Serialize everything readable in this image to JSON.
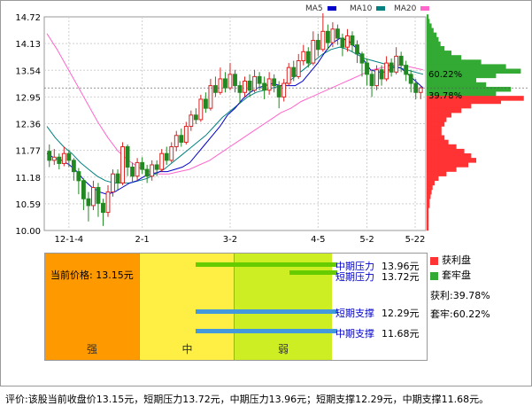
{
  "legend": [
    {
      "label": "MA5",
      "color": "#0000cc"
    },
    {
      "label": "MA10",
      "color": "#008080"
    },
    {
      "label": "MA20",
      "color": "#ff66cc"
    }
  ],
  "chart_data": {
    "type": "candlestick",
    "y_ticks": [
      "14.72",
      "14.13",
      "13.54",
      "12.95",
      "12.36",
      "11.77",
      "11.18",
      "10.59",
      "10.00"
    ],
    "ylim": [
      10.0,
      14.72
    ],
    "x_ticks": [
      "12-1-4",
      "2-1",
      "3-2",
      "4-5",
      "5-2",
      "5-22"
    ],
    "candles": [
      [
        11.75,
        11.55,
        11.9,
        11.4
      ],
      [
        11.55,
        11.62,
        11.8,
        11.45
      ],
      [
        11.62,
        11.48,
        11.7,
        11.35
      ],
      [
        11.48,
        11.7,
        11.85,
        11.42
      ],
      [
        11.7,
        11.55,
        11.78,
        11.4
      ],
      [
        11.55,
        11.3,
        11.6,
        11.1
      ],
      [
        11.3,
        11.1,
        11.38,
        10.8
      ],
      [
        11.1,
        10.7,
        11.15,
        10.45
      ],
      [
        10.7,
        10.55,
        10.85,
        10.2
      ],
      [
        10.55,
        10.95,
        11.1,
        10.45
      ],
      [
        10.95,
        10.6,
        11.05,
        10.3
      ],
      [
        10.6,
        10.4,
        10.7,
        10.1
      ],
      [
        10.4,
        10.85,
        11.0,
        10.3
      ],
      [
        10.85,
        11.25,
        11.35,
        10.75
      ],
      [
        11.25,
        11.05,
        11.35,
        10.9
      ],
      [
        11.05,
        11.85,
        11.95,
        11.0
      ],
      [
        11.85,
        11.4,
        11.9,
        11.2
      ],
      [
        11.4,
        11.2,
        11.5,
        11.05
      ],
      [
        11.2,
        11.5,
        11.6,
        11.1
      ],
      [
        11.5,
        11.35,
        11.62,
        11.25
      ],
      [
        11.35,
        11.2,
        11.45,
        11.05
      ],
      [
        11.2,
        11.45,
        11.55,
        11.1
      ],
      [
        11.45,
        11.35,
        11.55,
        11.2
      ],
      [
        11.35,
        11.7,
        11.8,
        11.3
      ],
      [
        11.7,
        11.55,
        11.85,
        11.45
      ],
      [
        11.55,
        11.85,
        11.95,
        11.5
      ],
      [
        11.85,
        12.1,
        12.2,
        11.75
      ],
      [
        12.1,
        11.95,
        12.25,
        11.85
      ],
      [
        11.95,
        12.3,
        12.4,
        11.9
      ],
      [
        12.3,
        12.55,
        12.65,
        12.2
      ],
      [
        12.55,
        12.45,
        12.7,
        12.35
      ],
      [
        12.45,
        12.9,
        13.0,
        12.4
      ],
      [
        12.9,
        12.7,
        13.05,
        12.6
      ],
      [
        12.7,
        13.2,
        13.35,
        12.65
      ],
      [
        13.2,
        13.05,
        13.4,
        12.95
      ],
      [
        13.05,
        13.35,
        13.6,
        13.0
      ],
      [
        13.35,
        13.15,
        13.5,
        13.05
      ],
      [
        13.15,
        13.45,
        13.7,
        13.1
      ],
      [
        13.45,
        13.2,
        13.55,
        13.05
      ],
      [
        13.2,
        13.05,
        13.3,
        12.8
      ],
      [
        13.05,
        13.3,
        13.4,
        12.95
      ],
      [
        13.3,
        13.1,
        13.45,
        12.95
      ],
      [
        13.1,
        13.4,
        13.55,
        13.05
      ],
      [
        13.4,
        13.25,
        13.5,
        13.1
      ],
      [
        13.25,
        13.1,
        13.4,
        12.9
      ],
      [
        13.1,
        13.35,
        13.5,
        13.0
      ],
      [
        13.35,
        13.2,
        13.45,
        13.05
      ],
      [
        13.2,
        12.95,
        13.3,
        12.7
      ],
      [
        12.95,
        13.25,
        13.35,
        12.85
      ],
      [
        13.25,
        13.6,
        13.7,
        13.2
      ],
      [
        13.6,
        13.4,
        13.75,
        13.3
      ],
      [
        13.4,
        13.75,
        13.9,
        13.35
      ],
      [
        13.75,
        13.95,
        14.1,
        13.65
      ],
      [
        13.95,
        13.7,
        14.05,
        13.6
      ],
      [
        13.7,
        14.2,
        14.4,
        13.65
      ],
      [
        14.2,
        14.0,
        14.35,
        13.85
      ],
      [
        14.0,
        14.4,
        14.8,
        13.95
      ],
      [
        14.4,
        14.15,
        14.55,
        14.0
      ],
      [
        14.15,
        14.45,
        14.6,
        14.05
      ],
      [
        14.45,
        14.25,
        14.55,
        14.1
      ],
      [
        14.25,
        14.05,
        14.35,
        13.85
      ],
      [
        14.05,
        14.3,
        14.45,
        13.95
      ],
      [
        14.3,
        14.1,
        14.4,
        13.95
      ],
      [
        14.1,
        13.9,
        14.2,
        13.7
      ],
      [
        13.9,
        13.7,
        13.95,
        13.4
      ],
      [
        13.7,
        13.45,
        13.8,
        13.2
      ],
      [
        13.45,
        13.2,
        13.55,
        12.95
      ],
      [
        13.2,
        13.55,
        13.65,
        13.1
      ],
      [
        13.55,
        13.35,
        13.65,
        13.2
      ],
      [
        13.35,
        13.7,
        13.85,
        13.3
      ],
      [
        13.7,
        13.5,
        13.8,
        13.4
      ],
      [
        13.5,
        13.85,
        14.05,
        13.45
      ],
      [
        13.85,
        13.65,
        13.95,
        13.5
      ],
      [
        13.65,
        13.45,
        13.75,
        13.3
      ],
      [
        13.45,
        13.25,
        13.55,
        13.05
      ],
      [
        13.25,
        13.05,
        13.35,
        12.9
      ],
      [
        13.05,
        13.15,
        13.2,
        12.9
      ]
    ],
    "ma5": [
      11.7,
      11.6,
      11.55,
      11.45,
      11.3,
      11.1,
      10.95,
      10.85,
      10.8,
      10.85,
      10.95,
      11.05,
      11.1,
      11.2,
      11.25,
      11.3,
      11.3,
      11.35,
      11.4,
      11.5,
      11.7,
      11.9,
      12.1,
      12.3,
      12.55,
      12.7,
      12.9,
      13.05,
      13.15,
      13.2,
      13.25,
      13.2,
      13.2,
      13.2,
      13.3,
      13.5,
      13.7,
      13.95,
      14.15,
      14.25,
      14.2,
      14.05,
      13.8,
      13.55,
      13.5,
      13.5,
      13.6,
      13.6,
      13.45,
      13.3,
      13.15
    ],
    "ma10": [
      12.3,
      12.05,
      11.85,
      11.7,
      11.5,
      11.35,
      11.2,
      11.1,
      11.05,
      11.05,
      11.05,
      11.1,
      11.15,
      11.25,
      11.35,
      11.5,
      11.65,
      11.8,
      11.95,
      12.1,
      12.3,
      12.5,
      12.65,
      12.8,
      12.95,
      13.05,
      13.1,
      13.15,
      13.2,
      13.3,
      13.45,
      13.6,
      13.75,
      13.9,
      14.0,
      14.05,
      14.0,
      13.9,
      13.8,
      13.75,
      13.7,
      13.65,
      13.6,
      13.55,
      13.5,
      13.45
    ],
    "ma20": [
      14.35,
      14.0,
      13.6,
      13.2,
      12.8,
      12.4,
      12.05,
      11.75,
      11.55,
      11.4,
      11.3,
      11.25,
      11.25,
      11.3,
      11.35,
      11.45,
      11.55,
      11.7,
      11.85,
      12.0,
      12.15,
      12.3,
      12.45,
      12.6,
      12.7,
      12.85,
      12.95,
      13.05,
      13.15,
      13.25,
      13.35,
      13.45,
      13.55,
      13.6,
      13.65,
      13.65,
      13.6,
      13.55
    ],
    "chip_profile_labels": [
      "60.22%",
      "39.78%"
    ],
    "chip_profile_red": [
      [
        12.92,
        0.98
      ],
      [
        12.85,
        0.75
      ],
      [
        12.75,
        0.45
      ],
      [
        12.65,
        0.35
      ],
      [
        12.55,
        0.25
      ],
      [
        12.45,
        0.2
      ],
      [
        12.35,
        0.18
      ],
      [
        12.25,
        0.15
      ],
      [
        12.15,
        0.15
      ],
      [
        12.05,
        0.18
      ],
      [
        11.95,
        0.22
      ],
      [
        11.85,
        0.3
      ],
      [
        11.75,
        0.38
      ],
      [
        11.65,
        0.45
      ],
      [
        11.55,
        0.5
      ],
      [
        11.45,
        0.42
      ],
      [
        11.35,
        0.3
      ],
      [
        11.25,
        0.2
      ],
      [
        11.15,
        0.12
      ],
      [
        11.05,
        0.08
      ],
      [
        10.95,
        0.06
      ],
      [
        10.85,
        0.05
      ],
      [
        10.75,
        0.04
      ],
      [
        10.65,
        0.03
      ],
      [
        10.55,
        0.03
      ],
      [
        10.45,
        0.02
      ],
      [
        10.35,
        0.02
      ],
      [
        10.25,
        0.02
      ],
      [
        10.15,
        0.02
      ],
      [
        10.05,
        0.02
      ]
    ],
    "chip_profile_green": [
      [
        14.72,
        0.02
      ],
      [
        14.62,
        0.03
      ],
      [
        14.52,
        0.05
      ],
      [
        14.42,
        0.07
      ],
      [
        14.32,
        0.1
      ],
      [
        14.22,
        0.12
      ],
      [
        14.12,
        0.14
      ],
      [
        14.02,
        0.18
      ],
      [
        13.92,
        0.25
      ],
      [
        13.82,
        0.35
      ],
      [
        13.72,
        0.55
      ],
      [
        13.62,
        0.8
      ],
      [
        13.52,
        0.95
      ],
      [
        13.42,
        0.7
      ],
      [
        13.32,
        0.5
      ],
      [
        13.22,
        0.6
      ],
      [
        13.12,
        0.85
      ],
      [
        13.02,
        0.7
      ]
    ]
  },
  "price_panel": {
    "current_price": "当前价格: 13.15元",
    "zones": [
      "强",
      "中",
      "弱"
    ],
    "levels": [
      {
        "name": "中期压力",
        "value": "13.96元",
        "bar_color": "#66cc00"
      },
      {
        "name": "短期压力",
        "value": "13.72元",
        "bar_color": "#66cc00"
      },
      {
        "name": "短期支撑",
        "value": "12.29元",
        "bar_color": "#4499dd"
      },
      {
        "name": "中期支撑",
        "value": "11.68元",
        "bar_color": "#4499dd"
      }
    ]
  },
  "side_legend": {
    "profit_label": "获利盘",
    "profit_color": "#ff3333",
    "trapped_label": "套牢盘",
    "trapped_color": "#33aa33",
    "profit_value": "获利:39.78%",
    "trapped_value": "套牢:60.22%"
  },
  "footer_text": "评价:该股当前收盘价13.15元，短期压力13.72元，中期压力13.96元；短期支撑12.29元，中期支撑11.68元。"
}
